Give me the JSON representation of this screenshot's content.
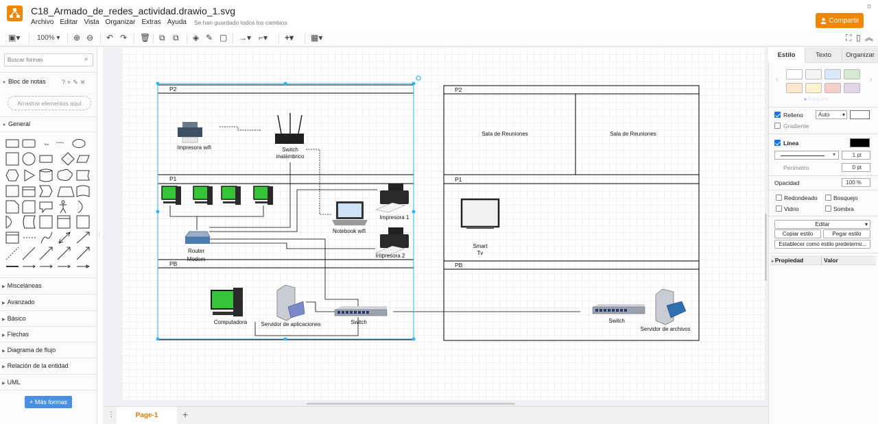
{
  "app": {
    "file_title": "C18_Armado_de_redes_actividad.drawio_1.svg",
    "menus": [
      "Archivo",
      "Editar",
      "Vista",
      "Organizar",
      "Extras",
      "Ayuda"
    ],
    "save_status": "Se han guardado todos los cambios",
    "share_label": "Compartir",
    "accent_color": "#f08705"
  },
  "toolbar": {
    "zoom": "100%"
  },
  "left_panel": {
    "search_placeholder": "Buscar formas",
    "scratchpad_title": "Bloc de notas",
    "scratchpad_help": "?",
    "drag_hint": "Arrastrar elementos aquí",
    "general_title": "General",
    "sections": [
      "Misceláneas",
      "Avanzado",
      "Básico",
      "Flechas",
      "Diagrama de flujo",
      "Relación de la entidad",
      "UML"
    ],
    "more_shapes": "Más formas"
  },
  "pages": {
    "active": "Page-1"
  },
  "diagram": {
    "left_building": {
      "floor_p2": "P2",
      "floor_p1": "P1",
      "floor_pb": "PB",
      "wifi_printer": "Impresora wifi",
      "wireless_switch": "Switch\ninalámbrico",
      "notebook": "Notebook wifi",
      "printer_1": "Impresora 1",
      "printer_2": "Impresora 2",
      "router": "Router\nModem",
      "computer": "Computadora",
      "app_server": "Servidor de aplicaciones",
      "switch": "Switch"
    },
    "right_building": {
      "floor_p2": "P2",
      "floor_p1": "P1",
      "floor_pb": "PB",
      "room_a": "Sala de Reuniones",
      "room_b": "Sala de Reuniones",
      "smart_tv": "Smart\nTv",
      "switch": "Switch",
      "file_server": "Servidor de archivos"
    }
  },
  "right_panel": {
    "tabs": [
      "Estilo",
      "Texto",
      "Organizar"
    ],
    "swatch_colors": [
      "#ffffff",
      "#f5f5f5",
      "#dae8fc",
      "#d5e8d4",
      "#ffe6cc",
      "#fff2cc",
      "#f8cecc",
      "#e1d5e7"
    ],
    "fill_label": "Relleno",
    "fill_value": "Auto",
    "gradient_label": "Gradiente",
    "line_label": "Línea",
    "line_width": "1 pt",
    "perimeter_label": "Perímetro",
    "perimeter_value": "0 pt",
    "opacity_label": "Opacidad",
    "opacity_value": "100 %",
    "rounded_label": "Redondeado",
    "sketch_label": "Bosquejo",
    "glass_label": "Vidrio",
    "shadow_label": "Sombra",
    "edit_select": "Editar",
    "copy_style": "Copiar estilo",
    "paste_style": "Pegar estilo",
    "set_default_style": "Establecer como estilo predetermi...",
    "property_header": "Propiedad",
    "value_header": "Valor"
  }
}
